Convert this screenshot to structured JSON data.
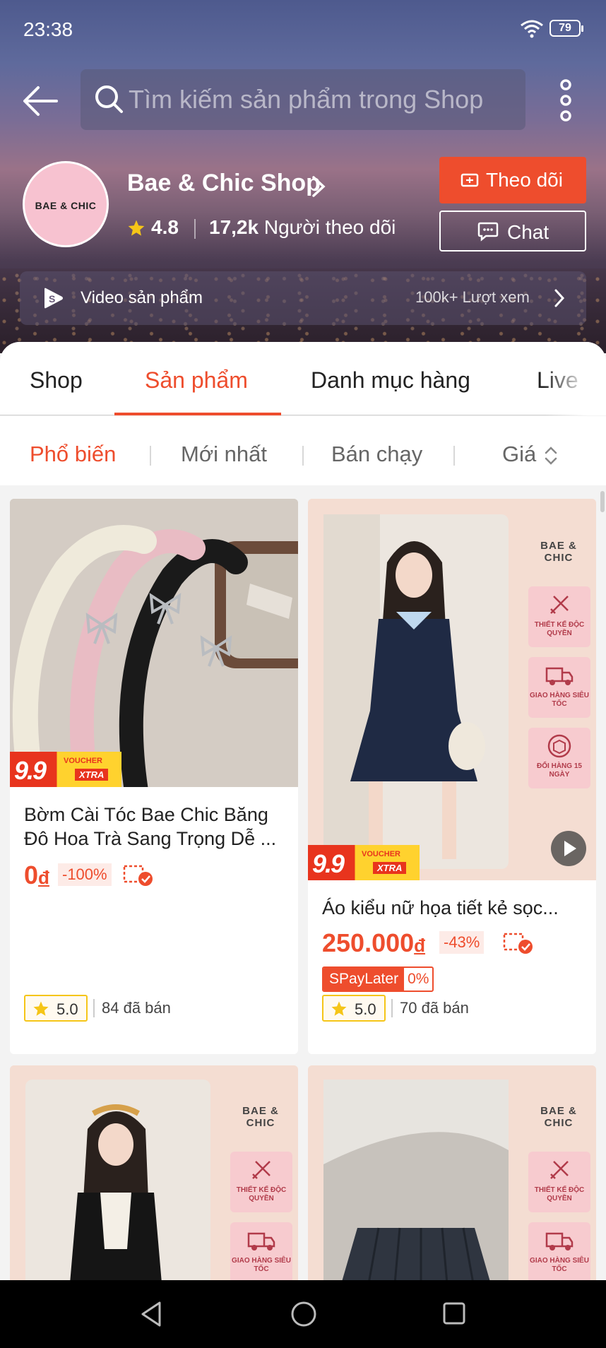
{
  "status": {
    "time": "23:38",
    "battery": "79"
  },
  "search": {
    "placeholder": "Tìm kiếm sản phẩm trong Shop"
  },
  "shop": {
    "avatar_text": "BAE & CHIC",
    "name": "Bae & Chic Shop",
    "rating": "4.8",
    "followers_count": "17,2k",
    "followers_label": "Người theo dõi",
    "follow_label": "Theo dõi",
    "chat_label": "Chat"
  },
  "video_bar": {
    "label": "Video sản phẩm",
    "views": "100k+ Lượt xem"
  },
  "tabs": [
    {
      "label": "Shop"
    },
    {
      "label": "Sản phẩm"
    },
    {
      "label": "Danh mục hàng"
    },
    {
      "label": "Live"
    }
  ],
  "sorts": [
    {
      "label": "Phổ biến"
    },
    {
      "label": "Mới nhất"
    },
    {
      "label": "Bán chạy"
    },
    {
      "label": "Giá"
    }
  ],
  "voucher": {
    "number": "9.9",
    "top": "VOUCHER",
    "xtra": "XTRA"
  },
  "brand_panel": {
    "brand": "BAE & CHIC",
    "badges": [
      "THIẾT KẾ ĐỘC QUYỀN",
      "GIAO HÀNG SIÊU TỐC",
      "ĐỔI HÀNG 15 NGÀY"
    ]
  },
  "products": [
    {
      "title": "Bờm Cài Tóc Bae Chic Băng Đô Hoa Trà Sang Trọng Dễ ...",
      "price": "0",
      "currency": "đ",
      "discount": "-100%",
      "rating": "5.0",
      "sold": "84 đã bán"
    },
    {
      "title": "Áo kiểu nữ họa tiết kẻ sọc...",
      "price": "250.000",
      "currency": "đ",
      "discount": "-43%",
      "spaylater": "SPayLater",
      "spaylater_rate": "0%",
      "rating": "5.0",
      "sold": "70 đã bán"
    }
  ],
  "colors": {
    "accent": "#ee4d2d",
    "star": "#f5c518"
  }
}
